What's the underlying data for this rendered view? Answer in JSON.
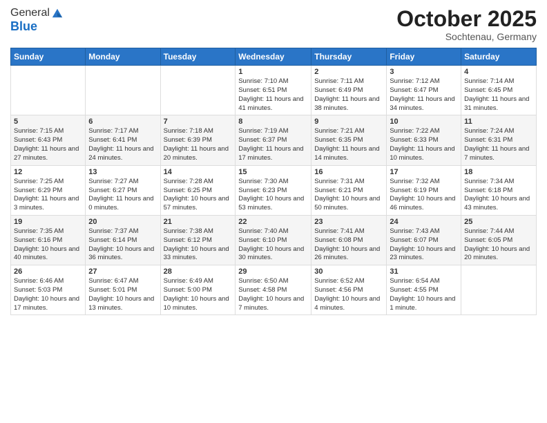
{
  "header": {
    "logo_line1": "General",
    "logo_line2": "Blue",
    "month": "October 2025",
    "location": "Sochtenau, Germany"
  },
  "days_of_week": [
    "Sunday",
    "Monday",
    "Tuesday",
    "Wednesday",
    "Thursday",
    "Friday",
    "Saturday"
  ],
  "weeks": [
    [
      {
        "day": "",
        "info": ""
      },
      {
        "day": "",
        "info": ""
      },
      {
        "day": "",
        "info": ""
      },
      {
        "day": "1",
        "info": "Sunrise: 7:10 AM\nSunset: 6:51 PM\nDaylight: 11 hours and 41 minutes."
      },
      {
        "day": "2",
        "info": "Sunrise: 7:11 AM\nSunset: 6:49 PM\nDaylight: 11 hours and 38 minutes."
      },
      {
        "day": "3",
        "info": "Sunrise: 7:12 AM\nSunset: 6:47 PM\nDaylight: 11 hours and 34 minutes."
      },
      {
        "day": "4",
        "info": "Sunrise: 7:14 AM\nSunset: 6:45 PM\nDaylight: 11 hours and 31 minutes."
      }
    ],
    [
      {
        "day": "5",
        "info": "Sunrise: 7:15 AM\nSunset: 6:43 PM\nDaylight: 11 hours and 27 minutes."
      },
      {
        "day": "6",
        "info": "Sunrise: 7:17 AM\nSunset: 6:41 PM\nDaylight: 11 hours and 24 minutes."
      },
      {
        "day": "7",
        "info": "Sunrise: 7:18 AM\nSunset: 6:39 PM\nDaylight: 11 hours and 20 minutes."
      },
      {
        "day": "8",
        "info": "Sunrise: 7:19 AM\nSunset: 6:37 PM\nDaylight: 11 hours and 17 minutes."
      },
      {
        "day": "9",
        "info": "Sunrise: 7:21 AM\nSunset: 6:35 PM\nDaylight: 11 hours and 14 minutes."
      },
      {
        "day": "10",
        "info": "Sunrise: 7:22 AM\nSunset: 6:33 PM\nDaylight: 11 hours and 10 minutes."
      },
      {
        "day": "11",
        "info": "Sunrise: 7:24 AM\nSunset: 6:31 PM\nDaylight: 11 hours and 7 minutes."
      }
    ],
    [
      {
        "day": "12",
        "info": "Sunrise: 7:25 AM\nSunset: 6:29 PM\nDaylight: 11 hours and 3 minutes."
      },
      {
        "day": "13",
        "info": "Sunrise: 7:27 AM\nSunset: 6:27 PM\nDaylight: 11 hours and 0 minutes."
      },
      {
        "day": "14",
        "info": "Sunrise: 7:28 AM\nSunset: 6:25 PM\nDaylight: 10 hours and 57 minutes."
      },
      {
        "day": "15",
        "info": "Sunrise: 7:30 AM\nSunset: 6:23 PM\nDaylight: 10 hours and 53 minutes."
      },
      {
        "day": "16",
        "info": "Sunrise: 7:31 AM\nSunset: 6:21 PM\nDaylight: 10 hours and 50 minutes."
      },
      {
        "day": "17",
        "info": "Sunrise: 7:32 AM\nSunset: 6:19 PM\nDaylight: 10 hours and 46 minutes."
      },
      {
        "day": "18",
        "info": "Sunrise: 7:34 AM\nSunset: 6:18 PM\nDaylight: 10 hours and 43 minutes."
      }
    ],
    [
      {
        "day": "19",
        "info": "Sunrise: 7:35 AM\nSunset: 6:16 PM\nDaylight: 10 hours and 40 minutes."
      },
      {
        "day": "20",
        "info": "Sunrise: 7:37 AM\nSunset: 6:14 PM\nDaylight: 10 hours and 36 minutes."
      },
      {
        "day": "21",
        "info": "Sunrise: 7:38 AM\nSunset: 6:12 PM\nDaylight: 10 hours and 33 minutes."
      },
      {
        "day": "22",
        "info": "Sunrise: 7:40 AM\nSunset: 6:10 PM\nDaylight: 10 hours and 30 minutes."
      },
      {
        "day": "23",
        "info": "Sunrise: 7:41 AM\nSunset: 6:08 PM\nDaylight: 10 hours and 26 minutes."
      },
      {
        "day": "24",
        "info": "Sunrise: 7:43 AM\nSunset: 6:07 PM\nDaylight: 10 hours and 23 minutes."
      },
      {
        "day": "25",
        "info": "Sunrise: 7:44 AM\nSunset: 6:05 PM\nDaylight: 10 hours and 20 minutes."
      }
    ],
    [
      {
        "day": "26",
        "info": "Sunrise: 6:46 AM\nSunset: 5:03 PM\nDaylight: 10 hours and 17 minutes."
      },
      {
        "day": "27",
        "info": "Sunrise: 6:47 AM\nSunset: 5:01 PM\nDaylight: 10 hours and 13 minutes."
      },
      {
        "day": "28",
        "info": "Sunrise: 6:49 AM\nSunset: 5:00 PM\nDaylight: 10 hours and 10 minutes."
      },
      {
        "day": "29",
        "info": "Sunrise: 6:50 AM\nSunset: 4:58 PM\nDaylight: 10 hours and 7 minutes."
      },
      {
        "day": "30",
        "info": "Sunrise: 6:52 AM\nSunset: 4:56 PM\nDaylight: 10 hours and 4 minutes."
      },
      {
        "day": "31",
        "info": "Sunrise: 6:54 AM\nSunset: 4:55 PM\nDaylight: 10 hours and 1 minute."
      },
      {
        "day": "",
        "info": ""
      }
    ]
  ]
}
